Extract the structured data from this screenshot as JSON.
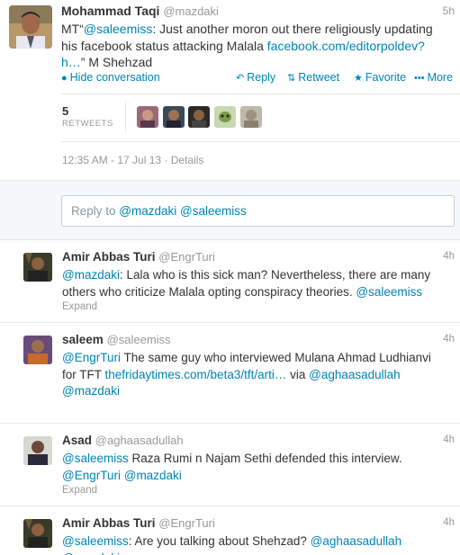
{
  "main": {
    "name": "Mohammad Taqi",
    "handle": "@mazdaki",
    "time": "5h",
    "text": {
      "prefix": "MT“",
      "mention": "@saleemiss",
      "body1": ": Just another moron out there religiously updating his facebook status attacking Malala ",
      "link": "facebook.com/editorpoldev?h…",
      "suffix": "” M Shehzad"
    },
    "actions": {
      "hide": "Hide conversation",
      "reply": "Reply",
      "retweet": "Retweet",
      "favorite": "Favorite",
      "more": "More"
    },
    "retweets": {
      "count": "5",
      "label": "RETWEETS"
    },
    "meta": "12:35 AM - 17 Jul 13 · Details"
  },
  "reply_box": {
    "prefix": "Reply to ",
    "mentions": "@mazdaki @saleemiss"
  },
  "replies": [
    {
      "name": "Amir Abbas Turi",
      "handle": "@EngrTuri",
      "time": "4h",
      "segments": [
        {
          "t": "@mazdaki",
          "link": true
        },
        {
          "t": ": Lala who is this sick man? Nevertheless, there are many others who criticize Malala opting conspiracy theories. ",
          "link": false
        },
        {
          "t": "@saleemiss",
          "link": true
        }
      ],
      "expand": "Expand"
    },
    {
      "name": "saleem",
      "handle": "@saleemiss",
      "time": "4h",
      "segments": [
        {
          "t": "@EngrTuri",
          "link": true
        },
        {
          "t": " The same guy who interviewed Mulana Ahmad Ludhianvi for TFT ",
          "link": false
        },
        {
          "t": "thefridaytimes.com/beta3/tft/arti…",
          "link": true
        },
        {
          "t": " via ",
          "link": false
        },
        {
          "t": "@aghaasadullah",
          "link": true
        },
        {
          "t": "  ",
          "link": false
        },
        {
          "t": "@mazdaki",
          "link": true
        }
      ],
      "expand": ""
    },
    {
      "name": "Asad",
      "handle": "@aghaasadullah",
      "time": "4h",
      "segments": [
        {
          "t": "@saleemiss",
          "link": true
        },
        {
          "t": " Raza Rumi n Najam Sethi defended this interview.  ",
          "link": false
        },
        {
          "t": "@EngrTuri",
          "link": true
        },
        {
          "t": " ",
          "link": false
        },
        {
          "t": "@mazdaki",
          "link": true
        }
      ],
      "expand": "Expand"
    },
    {
      "name": "Amir Abbas Turi",
      "handle": "@EngrTuri",
      "time": "4h",
      "segments": [
        {
          "t": "@saleemiss",
          "link": true
        },
        {
          "t": ": Are you talking about Shehzad?  ",
          "link": false
        },
        {
          "t": "@aghaasadullah",
          "link": true
        },
        {
          "t": "  ",
          "link": false
        },
        {
          "t": "@mazdaki",
          "link": true
        }
      ],
      "expand": ""
    }
  ],
  "colors": {
    "link": "#0084b4",
    "muted": "#999999",
    "text": "#333333"
  }
}
